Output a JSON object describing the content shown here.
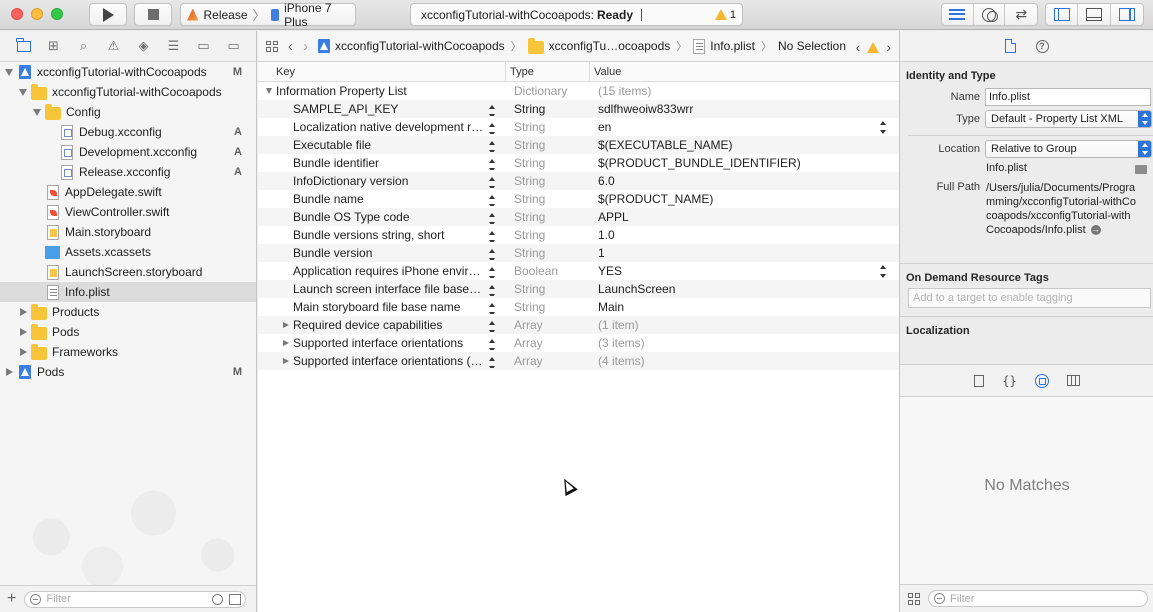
{
  "window": {
    "scheme": "Release",
    "device": "iPhone 7 Plus",
    "activity_project": "xcconfigTutorial-withCocoapods:",
    "activity_status": "Ready",
    "warning_count": "1"
  },
  "navigator": {
    "rows": [
      {
        "label": "xcconfigTutorial-withCocoapods",
        "badge": "M"
      },
      {
        "label": "xcconfigTutorial-withCocoapods",
        "badge": ""
      },
      {
        "label": "Config",
        "badge": ""
      },
      {
        "label": "Debug.xcconfig",
        "badge": "A"
      },
      {
        "label": "Development.xcconfig",
        "badge": "A"
      },
      {
        "label": "Release.xcconfig",
        "badge": "A"
      },
      {
        "label": "AppDelegate.swift",
        "badge": ""
      },
      {
        "label": "ViewController.swift",
        "badge": ""
      },
      {
        "label": "Main.storyboard",
        "badge": ""
      },
      {
        "label": "Assets.xcassets",
        "badge": ""
      },
      {
        "label": "LaunchScreen.storyboard",
        "badge": ""
      },
      {
        "label": "Info.plist",
        "badge": ""
      },
      {
        "label": "Products",
        "badge": ""
      },
      {
        "label": "Pods",
        "badge": ""
      },
      {
        "label": "Frameworks",
        "badge": ""
      },
      {
        "label": "Pods",
        "badge": "M"
      }
    ],
    "filter_placeholder": "Filter"
  },
  "jumpbar": {
    "crumbs": [
      "xcconfigTutorial-withCocoapods",
      "xcconfigTu…ocoapods",
      "Info.plist",
      "No Selection"
    ]
  },
  "plist": {
    "headers": {
      "key": "Key",
      "type": "Type",
      "value": "Value"
    },
    "rows": [
      {
        "key": "Information Property List",
        "type": "Dictionary",
        "value": "(15 items)"
      },
      {
        "key": "SAMPLE_API_KEY",
        "type": "String",
        "value": "sdlfhweoiw833wrr"
      },
      {
        "key": "Localization native development re…",
        "type": "String",
        "value": "en"
      },
      {
        "key": "Executable file",
        "type": "String",
        "value": "$(EXECUTABLE_NAME)"
      },
      {
        "key": "Bundle identifier",
        "type": "String",
        "value": "$(PRODUCT_BUNDLE_IDENTIFIER)"
      },
      {
        "key": "InfoDictionary version",
        "type": "String",
        "value": "6.0"
      },
      {
        "key": "Bundle name",
        "type": "String",
        "value": "$(PRODUCT_NAME)"
      },
      {
        "key": "Bundle OS Type code",
        "type": "String",
        "value": "APPL"
      },
      {
        "key": "Bundle versions string, short",
        "type": "String",
        "value": "1.0"
      },
      {
        "key": "Bundle version",
        "type": "String",
        "value": "1"
      },
      {
        "key": "Application requires iPhone enviro…",
        "type": "Boolean",
        "value": "YES"
      },
      {
        "key": "Launch screen interface file base…",
        "type": "String",
        "value": "LaunchScreen"
      },
      {
        "key": "Main storyboard file base name",
        "type": "String",
        "value": "Main"
      },
      {
        "key": "Required device capabilities",
        "type": "Array",
        "value": "(1 item)"
      },
      {
        "key": "Supported interface orientations",
        "type": "Array",
        "value": "(3 items)"
      },
      {
        "key": "Supported interface orientations (i…",
        "type": "Array",
        "value": "(4 items)"
      }
    ]
  },
  "inspector": {
    "identity_title": "Identity and Type",
    "name_label": "Name",
    "name_value": "Info.plist",
    "type_label": "Type",
    "type_value": "Default - Property List XML",
    "location_label": "Location",
    "location_value": "Relative to Group",
    "location_file": "Info.plist",
    "fullpath_label": "Full Path",
    "fullpath_value": "/Users/julia/Documents/Programming/xcconfigTutorial-withCocoapods/xcconfigTutorial-withCocoapods/Info.plist",
    "odr_title": "On Demand Resource Tags",
    "odr_placeholder": "Add to a target to enable tagging",
    "localization_title": "Localization",
    "no_matches": "No Matches",
    "filter_placeholder": "Filter"
  }
}
